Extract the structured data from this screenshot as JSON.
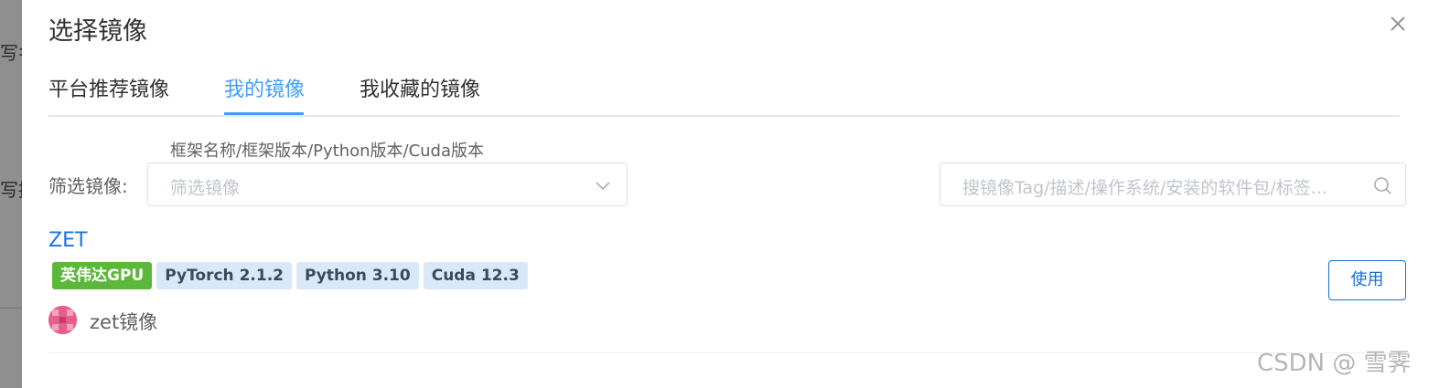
{
  "background": {
    "text_top": "写名",
    "text_bottom": "写描"
  },
  "dialog": {
    "title": "选择镜像",
    "tabs": [
      {
        "label": "平台推荐镜像",
        "active": false
      },
      {
        "label": "我的镜像",
        "active": true
      },
      {
        "label": "我收藏的镜像",
        "active": false
      }
    ]
  },
  "filter": {
    "label": "筛选镜像:",
    "hint": "框架名称/框架版本/Python版本/Cuda版本",
    "placeholder": "筛选镜像"
  },
  "search": {
    "placeholder": "搜镜像Tag/描述/操作系统/安装的软件包/标签..."
  },
  "image_item": {
    "name": "ZET",
    "tags": [
      "英伟达GPU",
      "PyTorch 2.1.2",
      "Python 3.10",
      "Cuda 12.3"
    ],
    "owner": "zet镜像",
    "use_label": "使用"
  },
  "watermark": "CSDN @  雪霁",
  "colors": {
    "accent": "#409eff",
    "link": "#1a73e8",
    "gpu_tag": "#5cb83a",
    "info_tag": "#d9e8f9"
  }
}
